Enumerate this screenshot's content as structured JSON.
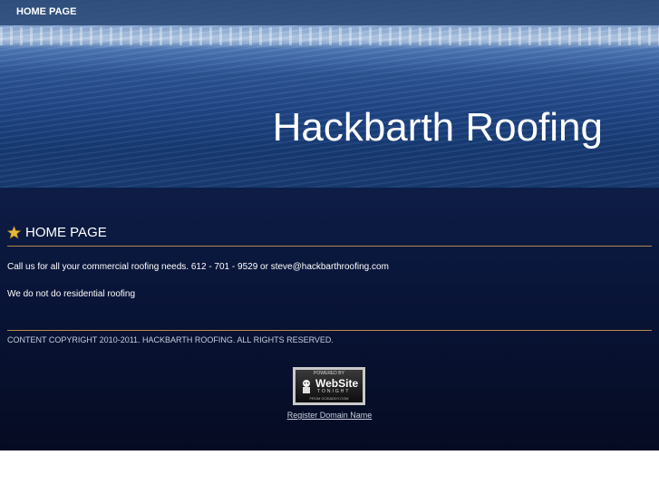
{
  "nav": {
    "items": [
      {
        "label": "HOME PAGE"
      }
    ]
  },
  "header": {
    "site_title": "Hackbarth Roofing"
  },
  "main": {
    "section_title": "HOME PAGE",
    "paragraphs": [
      "Call us for all your commercial roofing needs. 612 - 701 - 9529 or steve@hackbarthroofing.com",
      "We do not do residential roofing"
    ]
  },
  "footer": {
    "copyright": "CONTENT COPYRIGHT 2010-2011. HACKBARTH ROOFING. ALL RIGHTS RESERVED.",
    "badge": {
      "top": "POWERED BY",
      "main": "WebSite",
      "sub": "TONIGHT",
      "from": "FROM GODADDY.COM"
    },
    "register_link": "Register Domain Name"
  },
  "colors": {
    "accent_rule": "#b08a4a",
    "content_bg": "#091538",
    "star": "#e8b83c"
  }
}
